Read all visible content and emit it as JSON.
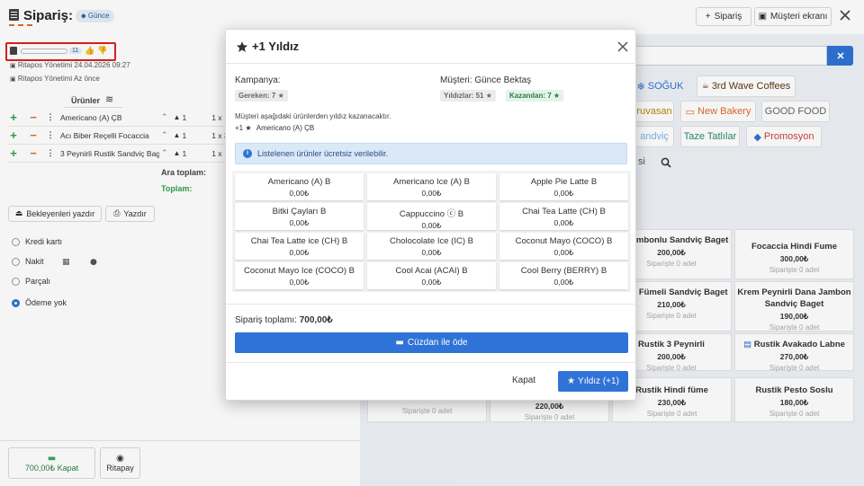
{
  "header": {
    "title": "Sipariş: 1",
    "tag": "Günce",
    "order_button": "Sipariş",
    "customer_screen_button": "Müşteri ekranı"
  },
  "left": {
    "badge_count": "11",
    "meta1": "Ritapos Yönetimi 24.04.2026 09:27",
    "meta2": "Ritapos Yönetimi Az önce",
    "products_header": "Ürünler",
    "orders": [
      {
        "name": "Americano (A) ÇB",
        "qty": "1",
        "mult": "1 x"
      },
      {
        "name": "Acı Biber Reçelli Focaccia",
        "qty": "1",
        "mult": "1 x 3"
      },
      {
        "name": "3 Peynirli Rustik Sandviç Baget",
        "qty": "1",
        "mult": "1 x"
      }
    ],
    "subtotal_label": "Ara toplam:",
    "total_label": "Toplam:",
    "print_pending": "Bekleyenleri yazdır",
    "print": "Yazdır",
    "payments": [
      "Kredi kartı",
      "Nakit",
      "Parçalı",
      "Ödeme yok"
    ],
    "kapat_button": "700,00₺ Kapat",
    "ritapay_button": "Ritapay"
  },
  "right": {
    "chips": [
      "SOĞUK",
      "3rd Wave Coffees",
      "ruvasan",
      "New Bakery",
      "GOOD FOOD",
      "andviç",
      "Taze Tatlılar",
      "Promosyon",
      "si"
    ],
    "products": [
      {
        "title": "na Jambonlu Sandviç Baget",
        "price": "200,00₺",
        "sub": "Siparişte 0 adet"
      },
      {
        "title": "Focaccia Hindi Fume",
        "price": "300,00₺",
        "sub": "Siparişte 0 adet"
      },
      {
        "title": "Hindi Fümeli Sandviç Baget",
        "price": "210,00₺",
        "sub": "Siparişte 0 adet"
      },
      {
        "title": "Krem Peynirli Dana Jambon Sandviç Baget",
        "price": "190,00₺",
        "sub": "Siparişte 0 adet"
      },
      {
        "title": "Rustik 3 Peynirli",
        "price": "200,00₺",
        "sub": "Siparişte 0 adet"
      },
      {
        "title": "Rustik Avakado Labne",
        "price": "270,00₺",
        "sub": "Siparişte 0 adet"
      },
      {
        "title": "Rustik Hindi füme",
        "price": "230,00₺",
        "sub": "Siparişte 0 adet"
      },
      {
        "title": "Rustik Pesto Soslu",
        "price": "180,00₺",
        "sub": "Siparişte 0 adet"
      }
    ],
    "bottom_partial": [
      {
        "price": "220,00₺",
        "sub": "Siparişte 0 adet"
      },
      {
        "sub": "Siparişte 0 adet"
      }
    ]
  },
  "modal": {
    "title": "+1 Yıldız",
    "campaign_label": "Kampanya:",
    "required_tag": "Gereken: 7",
    "customer_label": "Müşteri: Günce Bektaş",
    "stars_tag": "Yıldızlar: 51",
    "earned_tag": "Kazanılan: 7",
    "earn_text": "Müşteri aşağıdaki ürünlerden yıldız kazanacaktır.",
    "earn_item_prefix": "+1",
    "earn_item": "Americano (A) ÇB",
    "info_text": "Listelenen ürünler ücretsiz verilebilir.",
    "items": [
      {
        "name": "Americano (A) B",
        "price": "0,00₺"
      },
      {
        "name": "Americano Ice (A) B",
        "price": "0,00₺"
      },
      {
        "name": "Apple Pie Latte B",
        "price": "0,00₺"
      },
      {
        "name": "Bitki Çayları B",
        "price": "0,00₺"
      },
      {
        "name": "Cappuccino ⓒ B",
        "price": "0,00₺"
      },
      {
        "name": "Chai Tea Latte (CH) B",
        "price": "0,00₺"
      },
      {
        "name": "Chai Tea Latte ice (CH) B",
        "price": "0,00₺"
      },
      {
        "name": "Cholocolate Ice (IC) B",
        "price": "0,00₺"
      },
      {
        "name": "Coconut Mayo (COCO) B",
        "price": "0,00₺"
      },
      {
        "name": "Coconut Mayo Ice (COCO) B",
        "price": "0,00₺"
      },
      {
        "name": "Cool Acai (ACAI) B",
        "price": "0,00₺"
      },
      {
        "name": "Cool Berry (BERRY) B",
        "price": "0,00₺"
      }
    ],
    "order_total_label": "Sipariş toplamı:",
    "order_total": "700,00₺",
    "wallet_button": "Cüzdan ile öde",
    "close_button": "Kapat",
    "star_button": "Yıldız (+1)"
  },
  "colors": {
    "accent": "#2f73d6",
    "green": "#2e9e4f",
    "orange": "#e0692f",
    "info_bg": "#dbe8f8"
  }
}
